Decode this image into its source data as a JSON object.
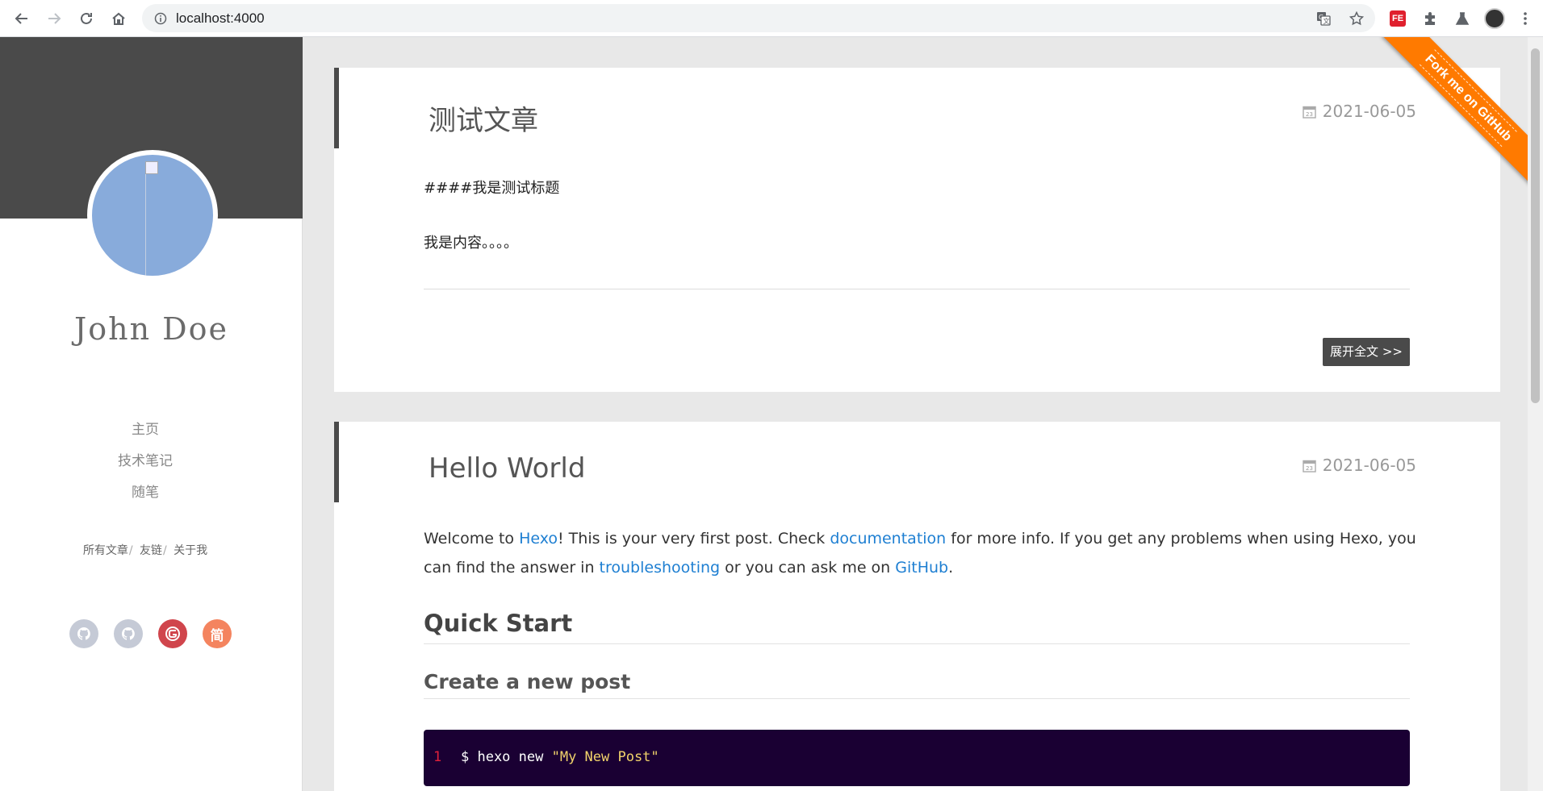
{
  "browser": {
    "url": "localhost:4000",
    "extension_fe_label": "FE"
  },
  "sidebar": {
    "author": "John Doe",
    "nav": [
      {
        "label": "主页"
      },
      {
        "label": "技术笔记"
      },
      {
        "label": "随笔"
      }
    ],
    "links": [
      {
        "label": "所有文章"
      },
      {
        "label": "友链"
      },
      {
        "label": "关于我"
      }
    ],
    "link_separator": "/",
    "social": [
      {
        "name": "github-icon",
        "color": "#c5cad6"
      },
      {
        "name": "github-icon",
        "color": "#c5cad6"
      },
      {
        "name": "gitee-icon",
        "color": "#d0454c"
      },
      {
        "name": "jianshu-icon",
        "color": "#f4845f",
        "label": "简"
      }
    ]
  },
  "posts": [
    {
      "title": "测试文章",
      "date": "2021-06-05",
      "paragraphs": [
        "####我是测试标题",
        "我是内容。。。。"
      ],
      "read_more": "展开全文 >>"
    },
    {
      "title": "Hello World",
      "date": "2021-06-05",
      "intro": {
        "t1": "Welcome to ",
        "link1": "Hexo",
        "t2": "! This is your very first post. Check ",
        "link2": "documentation",
        "t3": " for more info. If you get any problems when using Hexo, you can find the answer in ",
        "link3": "troubleshooting",
        "t4": " or you can ask me on ",
        "link4": "GitHub",
        "t5": "."
      },
      "h2": "Quick Start",
      "h3": "Create a new post",
      "code": {
        "line": "1",
        "prefix": "$ hexo new ",
        "string": "\"My New Post\""
      }
    }
  ],
  "ribbon": "Fork me on GitHub",
  "colors": {
    "sidebar_banner": "#4a4a4a",
    "link": "#1e7fd2",
    "ribbon": "#ff7a00",
    "code_bg": "#1a0033"
  }
}
